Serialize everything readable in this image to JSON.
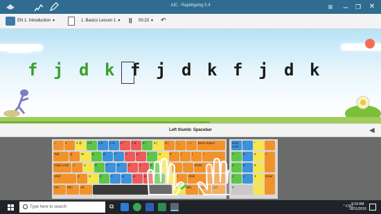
{
  "window": {
    "title": "AIC - Rapidtyping 5.4"
  },
  "toolbar": {
    "course": "EN 1. Introduction",
    "lesson": "1. Basics  Lesson 1",
    "timer": "00:23"
  },
  "lesson": {
    "typed": [
      "f",
      "j",
      "d",
      "k"
    ],
    "remaining": [
      "f",
      "j",
      "d",
      "k",
      "f",
      "j",
      "d",
      "k"
    ],
    "progress_fraction": 0.55
  },
  "hint": {
    "text": "Left thumb: Spacebar"
  },
  "keyboard": {
    "row1": [
      "~",
      "1",
      "2 @",
      "3 #",
      "4 $",
      "5 %",
      "6 ^",
      "7 &",
      "8 *",
      "9 (",
      "0 )",
      "- _",
      "= +",
      "Back Space"
    ],
    "row2": [
      "Tab",
      "Q",
      "W",
      "E",
      "R",
      "T",
      "Y",
      "U",
      "I",
      "O",
      "P",
      "[",
      "]",
      "\\"
    ],
    "row3": [
      "Caps Lock",
      "A",
      "S",
      "D",
      "F",
      "G",
      "H",
      "J",
      "K",
      "L",
      ";",
      "'",
      "Enter"
    ],
    "row4": [
      "Shift",
      "Z",
      "X",
      "C",
      "V",
      "B",
      "N",
      "M",
      ",",
      ".",
      "/",
      "Shift"
    ],
    "row5": [
      "Ctrl",
      "Win",
      "Alt",
      "",
      "Alt",
      "Win",
      "Menu",
      "Ctrl"
    ],
    "numpad": [
      "Num Lock",
      "/",
      "*",
      "-",
      "7",
      "8",
      "9",
      "+",
      "4",
      "5",
      "6",
      "",
      "1",
      "2",
      "3",
      "Enter",
      "0",
      ".",
      ""
    ]
  },
  "taskbar": {
    "search_placeholder": "Type here to search",
    "tray": "^  ENG",
    "time": "9:18 AM",
    "date": "18/11/2019"
  }
}
